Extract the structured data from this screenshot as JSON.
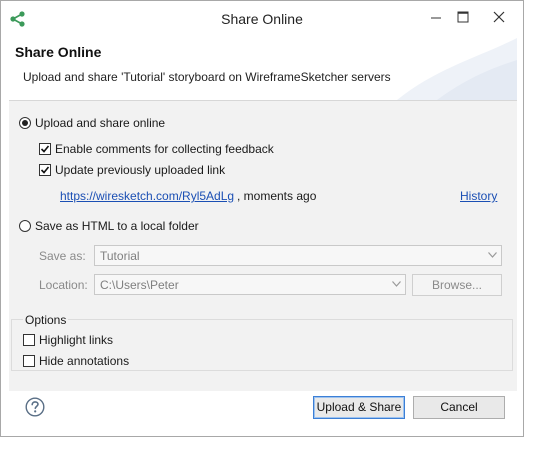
{
  "window": {
    "title": "Share Online"
  },
  "banner": {
    "title": "Share Online",
    "description": "Upload and share 'Tutorial' storyboard on WireframeSketcher servers"
  },
  "upload_option": {
    "label": "Upload and share online",
    "selected": true,
    "enable_comments": {
      "label": "Enable comments for collecting feedback",
      "checked": true
    },
    "update_link": {
      "label": "Update previously uploaded link",
      "checked": true
    },
    "link": {
      "url": "https://wiresketch.com/Ryl5AdLg",
      "suffix": ", moments ago"
    },
    "history_label": "History"
  },
  "html_option": {
    "label": "Save as HTML to a local folder",
    "selected": false,
    "save_as": {
      "label": "Save as:",
      "value": "Tutorial"
    },
    "location": {
      "label": "Location:",
      "value": "C:\\Users\\Peter"
    },
    "browse_label": "Browse..."
  },
  "options": {
    "title": "Options",
    "highlight_links": {
      "label": "Highlight links",
      "checked": false
    },
    "hide_annotations": {
      "label": "Hide annotations",
      "checked": false
    }
  },
  "buttons": {
    "upload_share": "Upload & Share",
    "cancel": "Cancel"
  },
  "icons": {
    "app": "share-icon",
    "help": "help-icon"
  },
  "colors": {
    "link": "#1b4fb4",
    "app_icon": "#3c9a5a",
    "dialog_bg": "#f2f2f2"
  }
}
